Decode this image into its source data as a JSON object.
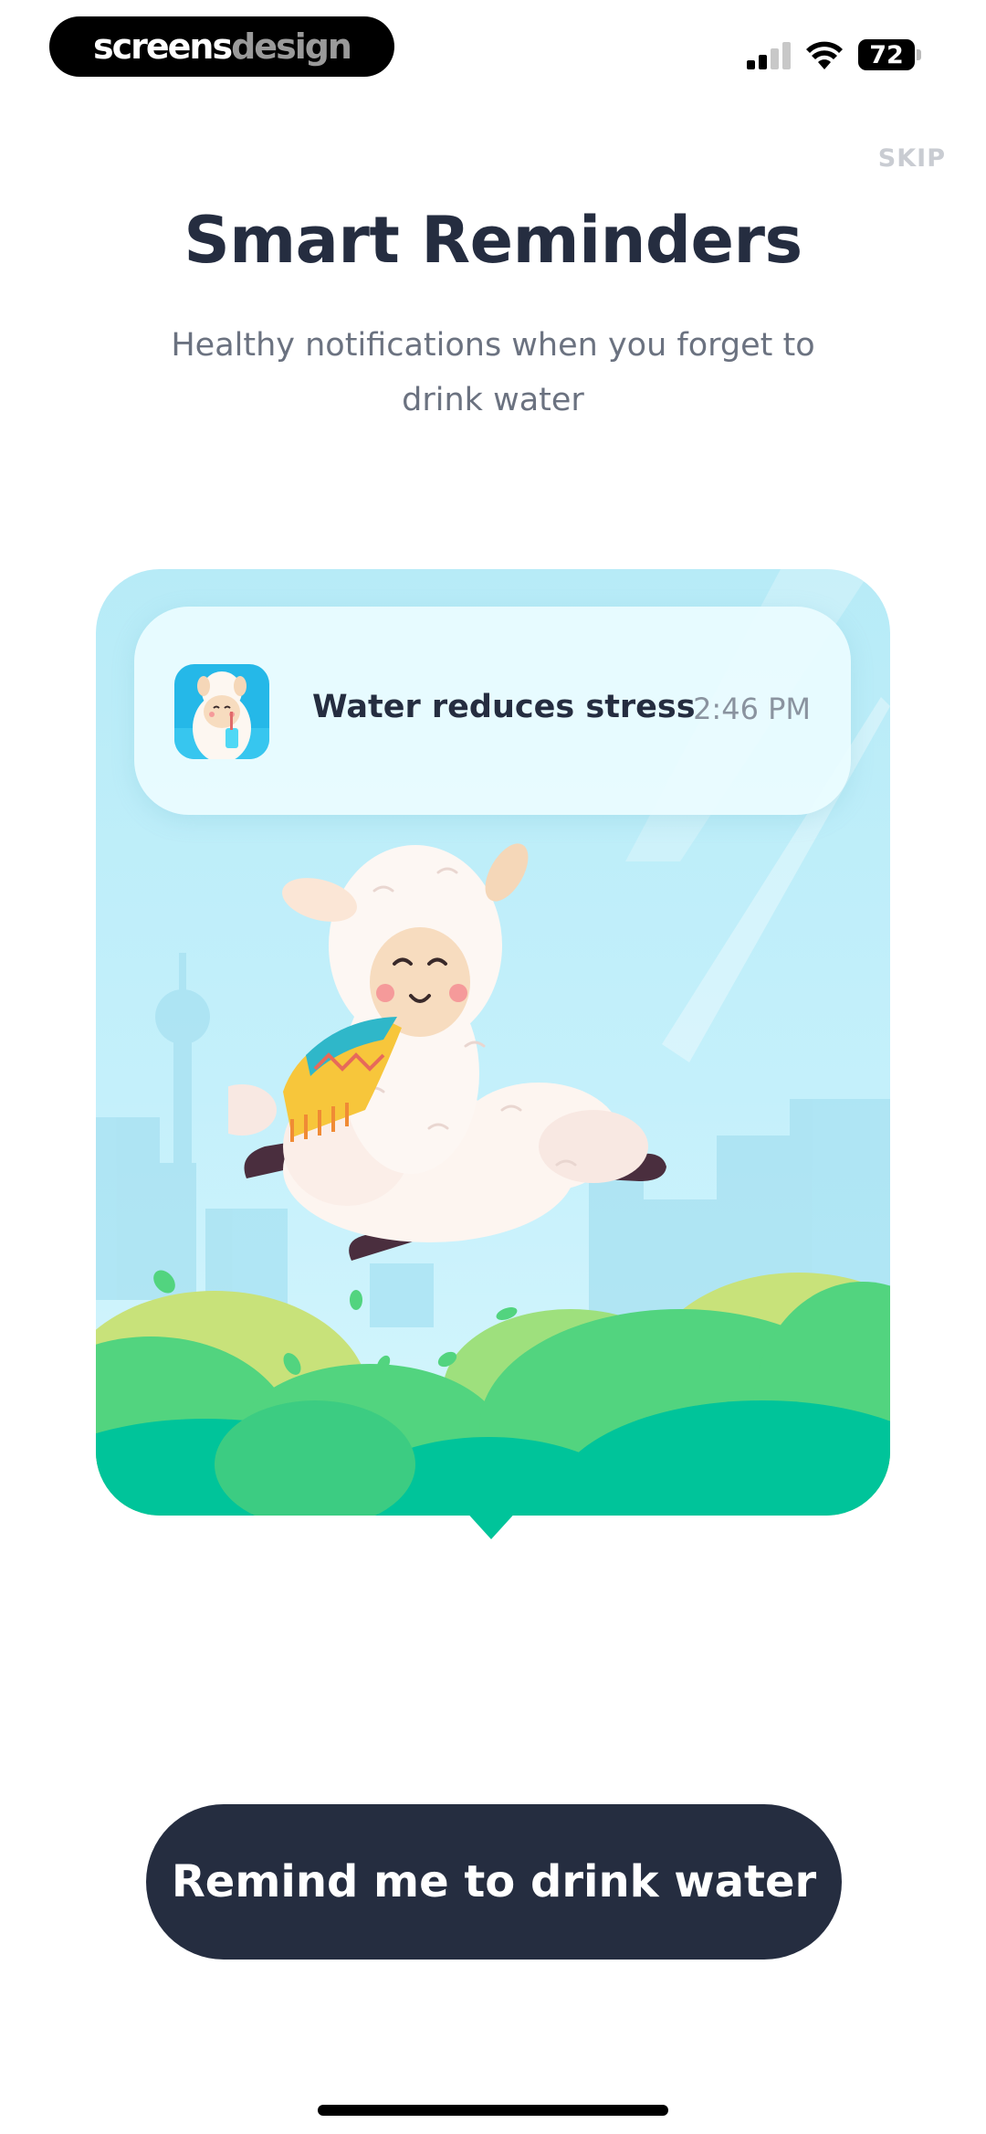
{
  "watermark": {
    "part1": "screens",
    "part2": "design"
  },
  "status_bar": {
    "battery": "72",
    "icons": [
      "signal-icon",
      "wifi-icon",
      "battery-icon"
    ]
  },
  "skip_label": "SKIP",
  "title": "Smart Reminders",
  "subtitle": "Healthy notifications when you forget to drink water",
  "notification": {
    "title": "Water reduces stress",
    "time": "2:46 PM",
    "icon": "llama-app-icon"
  },
  "illustration": "llama-illustration",
  "cta_label": "Remind me to drink water",
  "colors": {
    "primary_dark": "#252d40",
    "sky": "#b7ebf7",
    "grass": "#52d47f",
    "grass_dark": "#00c49a"
  }
}
